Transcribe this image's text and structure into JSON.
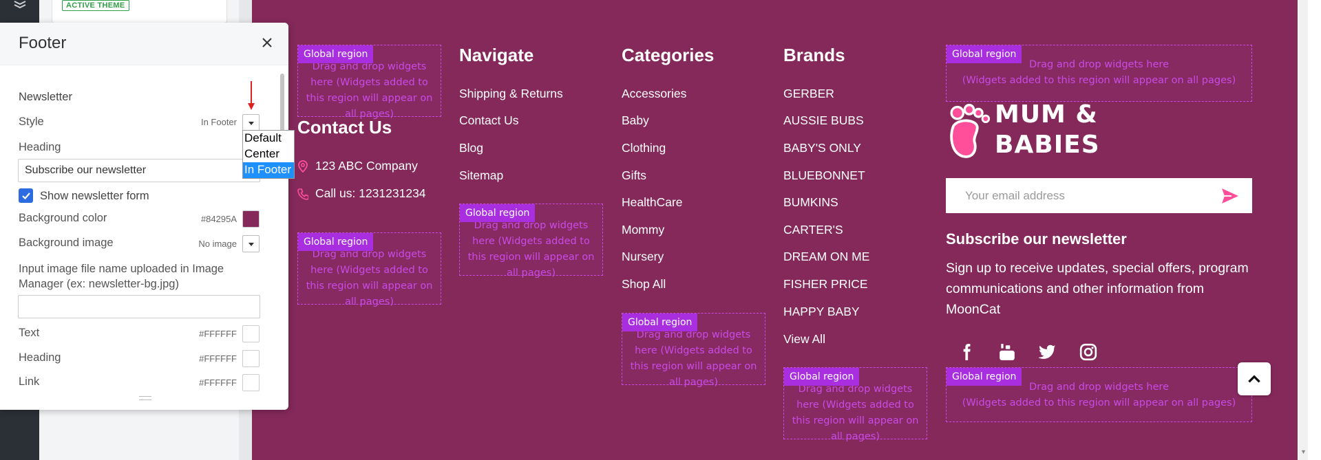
{
  "app": {
    "active_theme_badge": "ACTIVE THEME"
  },
  "panel": {
    "title": "Footer",
    "section": "Newsletter",
    "style_label": "Style",
    "style_value": "In Footer",
    "style_options": [
      "Default",
      "Center",
      "In Footer"
    ],
    "heading_label": "Heading",
    "heading_value": "Subscribe our newsletter",
    "show_form_label": "Show newsletter form",
    "show_form_checked": true,
    "bg_color_label": "Background color",
    "bg_color_value": "#84295A",
    "bg_image_label": "Background image",
    "bg_image_value": "No image",
    "image_input_label": "Input image file name uploaded in Image Manager (ex: newsletter-bg.jpg)",
    "image_input_value": "",
    "text_label": "Text",
    "text_color": "#FFFFFF",
    "heading_color_label": "Heading",
    "heading_color": "#FFFFFF",
    "link_label": "Link",
    "link_color": "#FFFFFF"
  },
  "global_region": {
    "tag": "Global region",
    "text_narrow": "Drag and drop widgets here (Widgets added to this region will appear on all pages)",
    "text_wide_1": "Drag and drop widgets here",
    "text_wide_2": "(Widgets added to this region will appear on all pages)"
  },
  "footer": {
    "bg_color": "#84295a",
    "contact": {
      "title": "Contact Us",
      "address": "123 ABC Company",
      "phone": "Call us: 1231231234"
    },
    "navigate": {
      "title": "Navigate",
      "items": [
        "Shipping & Returns",
        "Contact Us",
        "Blog",
        "Sitemap"
      ]
    },
    "categories": {
      "title": "Categories",
      "items": [
        "Accessories",
        "Baby",
        "Clothing",
        "Gifts",
        "HealthCare",
        "Mommy",
        "Nursery",
        "Shop All"
      ]
    },
    "brands": {
      "title": "Brands",
      "items": [
        "GERBER",
        "AUSSIE BUBS",
        "BABY'S ONLY",
        "BLUEBONNET",
        "BUMKINS",
        "CARTER'S",
        "DREAM ON ME",
        "FISHER PRICE",
        "HAPPY BABY",
        "View All"
      ]
    },
    "logo": {
      "line1": "MUM &",
      "line2": "BABIES"
    },
    "newsletter": {
      "placeholder": "Your email address",
      "heading": "Subscribe our newsletter",
      "description": "Sign up to receive updates, special offers, program communications and other information from MoonCat"
    },
    "social": [
      "facebook-icon",
      "youtube-icon",
      "twitter-icon",
      "instagram-icon"
    ]
  }
}
